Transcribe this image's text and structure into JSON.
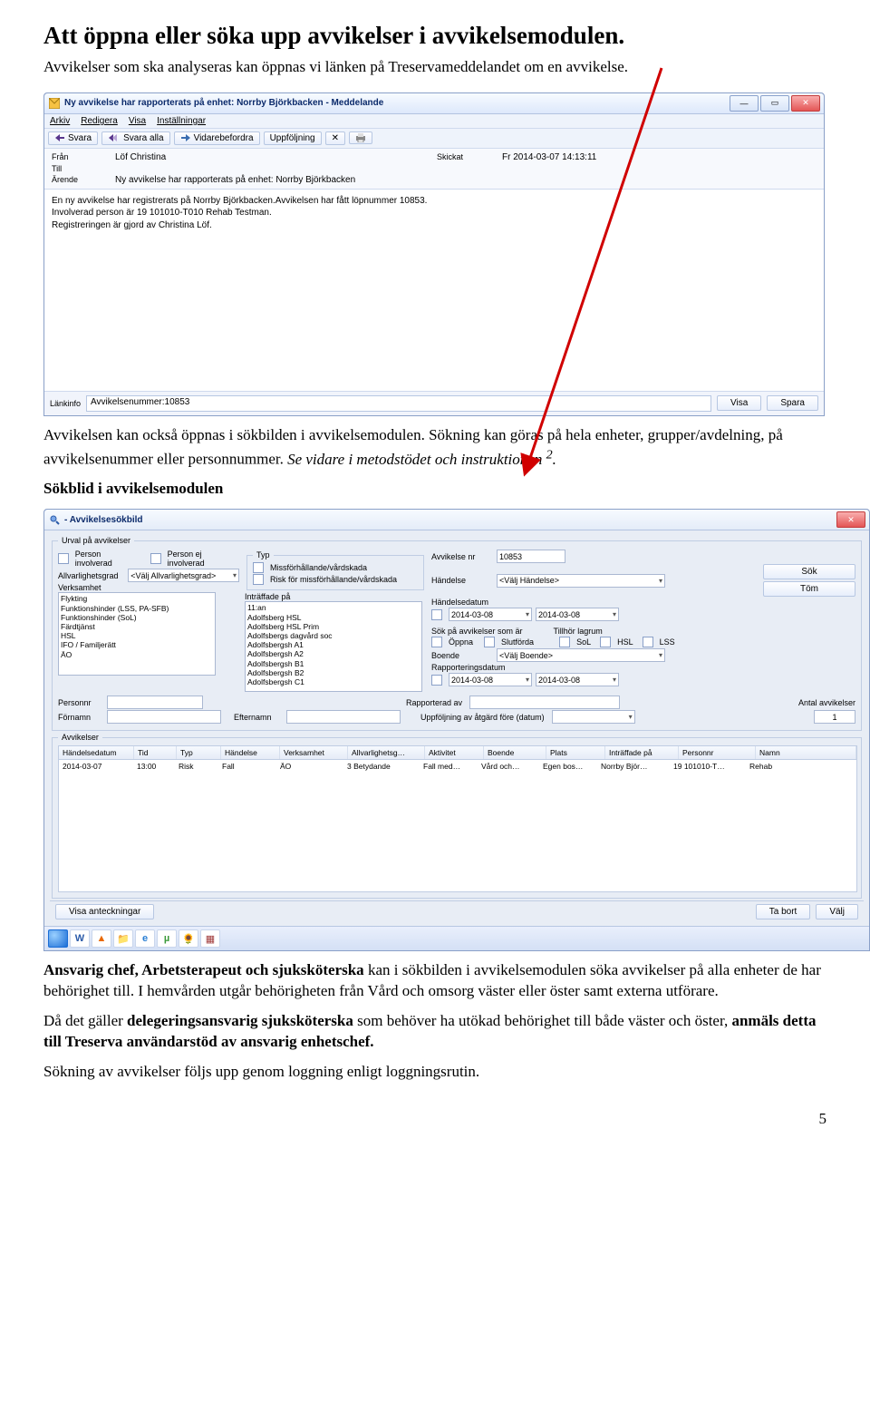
{
  "heading": "Att öppna eller söka upp avvikelser i avvikelsemodulen.",
  "lead": "Avvikelser som ska analyseras kan öppnas vi länken på Treservameddelandet om en avvikelse.",
  "mid1_a": "Avvikelsen kan också öppnas i sökbilden i avvikelsemodulen. Sökning kan göras på hela enheter, grupper/avdelning, på avvikelsenummer eller personnummer. ",
  "mid1_b": "Se vidare i metodstödet och instruktionen ",
  "mid1_sup": "2",
  "mid1_c": ".",
  "mid2": "Sökblid i avvikelsemodulen",
  "p3_a": "Ansvarig chef, Arbetsterapeut och sjuksköterska",
  "p3_b": " kan i sökbilden i avvikelsemodulen söka avvikelser på alla enheter de har behörighet till. I hemvården utgår behörigheten från Vård och omsorg väster eller öster samt externa utförare.",
  "p4_a": "Då det gäller ",
  "p4_b": "delegeringsansvarig sjuksköterska",
  "p4_c": " som behöver ha utökad behörighet till både väster och öster, ",
  "p4_d": "anmäls detta till Treserva användarstöd av ansvarig enhetschef.",
  "p5": "Sökning av avvikelser följs upp genom loggning enligt loggningsrutin.",
  "pagenum": "5",
  "msg": {
    "title": "Ny avvikelse har rapporterats på enhet: Norrby Björkbacken - Meddelande",
    "menu": {
      "arkiv": "Arkiv",
      "redigera": "Redigera",
      "visa": "Visa",
      "install": "Inställningar"
    },
    "tb": {
      "svara": "Svara",
      "svaraAlla": "Svara alla",
      "vidare": "Vidarebefordra",
      "uppfolj": "Uppföljning"
    },
    "meta": {
      "franL": "Från",
      "franV": "Löf Christina",
      "skickatL": "Skickat",
      "skickatV": "Fr 2014-03-07 14:13:11",
      "tillL": "Till",
      "tillV": "",
      "arendeL": "Ärende",
      "arendeV": "Ny avvikelse har rapporterats på enhet: Norrby Björkbacken"
    },
    "body1": "En ny avvikelse har registrerats på Norrby Björkbacken.Avvikelsen har fått löpnummer 10853.",
    "body2": "Involverad person är 19 101010-T010 Rehab Testman.",
    "body3": "Registreringen är gjord av Christina Löf.",
    "foot": {
      "lankL": "Länkinfo",
      "lankV": "Avvikelsenummer:10853",
      "visa": "Visa",
      "spara": "Spara"
    }
  },
  "sok": {
    "title": "- Avvikelsesökbild",
    "urval": "Urval på avvikelser",
    "personInv": "Person involverad",
    "personEj": "Person ej involverad",
    "allvarL": "Allvarlighetsgrad",
    "allvarV": "<Välj Allvarlighetsgrad>",
    "verkL": "Verksamhet",
    "verkItems": [
      "Flykting",
      "Funktionshinder (LSS, PA-SFB)",
      "Funktionshinder (SoL)",
      "Färdtjänst",
      "HSL",
      "IFO / Familjerätt",
      "ÄO"
    ],
    "typ": "Typ",
    "typ1": "Missförhållande/vårdskada",
    "typ2": "Risk för missförhållande/vårdskada",
    "intrL": "Inträffade på",
    "intrItems": [
      "11:an",
      "Adolfsberg HSL",
      "Adolfsberg HSL Prim",
      "Adolfsbergs dagvård soc",
      "Adolfsbergsh A1",
      "Adolfsbergsh A2",
      "Adolfsbergsh B1",
      "Adolfsbergsh B2",
      "Adolfsbergsh C1"
    ],
    "avvnrL": "Avvikelse nr",
    "avvnrV": "10853",
    "handL": "Händelse",
    "handV": "<Välj Händelse>",
    "sokBtn": "Sök",
    "tomBtn": "Töm",
    "hdatumL": "Händelsedatum",
    "d1": "2014-03-08",
    "d2": "2014-03-08",
    "sokArL": "Sök på avvikelser som är",
    "tillhorL": "Tillhör lagrum",
    "oppna": "Öppna",
    "slutforda": "Slutförda",
    "sol": "SoL",
    "hsl": "HSL",
    "lss": "LSS",
    "boendeL": "Boende",
    "boendeV": "<Välj Boende>",
    "rappDL": "Rapporteringsdatum",
    "personnrL": "Personnr",
    "forL": "Förnamn",
    "eftL": "Efternamn",
    "rappAvL": "Rapporterad av",
    "uppfL": "Uppföljning av åtgärd före (datum)",
    "antalL": "Antal avvikelser",
    "antalV": "1",
    "avvL": "Avvikelser",
    "th": [
      "Händelsedatum",
      "Tid",
      "Typ",
      "Händelse",
      "Verksamhet",
      "Allvarlighetsg…",
      "Aktivitet",
      "Boende",
      "Plats",
      "Inträffade på",
      "Personnr",
      "Namn"
    ],
    "tr": [
      "2014-03-07",
      "13:00",
      "Risk",
      "Fall",
      "ÄO",
      "3 Betydande",
      "Fall med…",
      "Vård och…",
      "Egen bos…",
      "Norrby Björ…",
      "19 101010-T…",
      "Rehab"
    ],
    "visaAnt": "Visa anteckningar",
    "taBort": "Ta bort",
    "valj": "Välj"
  }
}
